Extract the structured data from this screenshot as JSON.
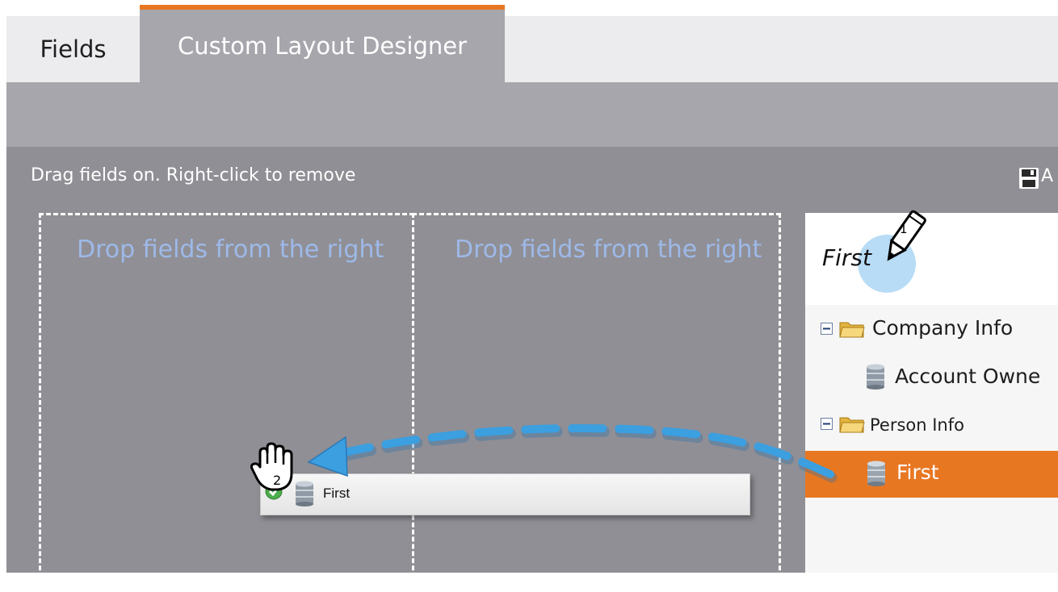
{
  "tabs": [
    {
      "label": "Fields",
      "active": false
    },
    {
      "label": "Custom Layout Designer",
      "active": true
    }
  ],
  "toolbar": {
    "instructions": "Drag fields on. Right-click to remove",
    "save_label_partial": "A"
  },
  "canvas": {
    "dropzones": [
      {
        "placeholder": "Drop fields from the right"
      },
      {
        "placeholder": "Drop fields from the right"
      }
    ],
    "dragged_field": {
      "label": "First",
      "status": "green-check-icon",
      "icon": "database-icon"
    }
  },
  "field_panel": {
    "search_value": "First",
    "tree": [
      {
        "label": "Company Info",
        "type": "folder",
        "expanded": true
      },
      {
        "label": "Account Owne",
        "type": "field"
      },
      {
        "label": "Person Info",
        "type": "folder",
        "expanded": true
      },
      {
        "label": "First",
        "type": "field",
        "selected": true
      }
    ]
  },
  "annotations": {
    "step1": "1",
    "step2": "2"
  },
  "colors": {
    "accent": "#e87722",
    "workspace": "#908f95",
    "toolbar": "#a7a6ac",
    "drop_text": "#9db9e8",
    "arrow": "#3b9fe0"
  }
}
